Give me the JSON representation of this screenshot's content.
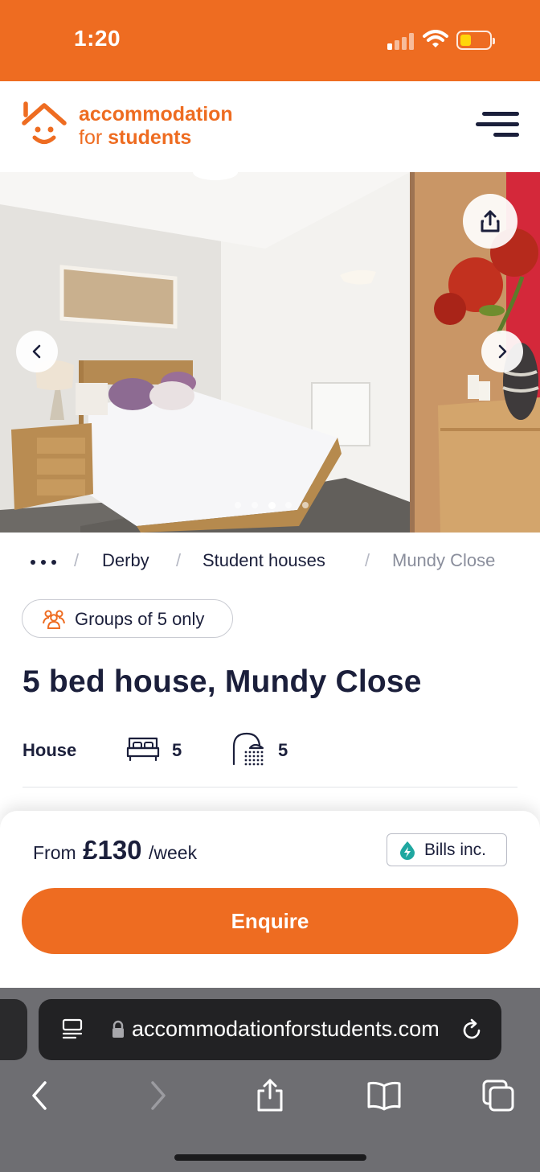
{
  "status_bar": {
    "time": "1:20",
    "signal_bars_active": 1,
    "battery_level": 0.3
  },
  "header": {
    "logo": {
      "line1": "accommodation",
      "line2_light": "for",
      "line2_bold": "students"
    },
    "menu_icon": "hamburger-menu-icon"
  },
  "gallery": {
    "total_images": 5,
    "active_index": 2,
    "prev_icon": "chevron-left-icon",
    "next_icon": "chevron-right-icon",
    "share_icon": "share-icon"
  },
  "breadcrumb": {
    "items": [
      "Derby",
      "Student houses",
      "Mundy Close"
    ],
    "separator": "/"
  },
  "listing": {
    "group_badge": "Groups of 5 only",
    "title": "5 bed house, Mundy Close",
    "type": "House",
    "bedrooms": "5",
    "bathrooms": "5"
  },
  "booking": {
    "price_prefix": "From",
    "price": "£130",
    "price_unit": "/week",
    "bills_badge": "Bills inc.",
    "enquire_label": "Enquire"
  },
  "browser": {
    "url_visible": "accommodationforstudents.com",
    "icons": [
      "reader-icon",
      "lock-icon",
      "reload-icon",
      "back-icon",
      "forward-icon",
      "share-icon",
      "bookmarks-icon",
      "tabs-icon"
    ]
  },
  "colors": {
    "brand": "#ee6c21",
    "navy": "#1b1f3b",
    "bills_icon": "#1fa7a0"
  }
}
